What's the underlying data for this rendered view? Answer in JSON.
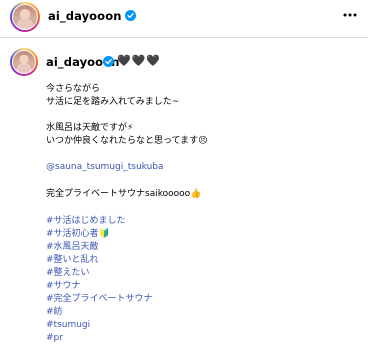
{
  "header": {
    "username": "ai_dayooon"
  },
  "caption": {
    "username": "ai_dayooon",
    "hearts": "🖤🖤🖤",
    "lines": [
      "今さらながら",
      "サ活に足を踏み入れてみました~",
      "水風呂は天敵ですが",
      "いつか仲良くなれたらなと思ってます",
      "@sauna_tsumugi_tsukuba",
      "完全プライベートサウナsaikooooo"
    ],
    "emojis": {
      "lightning": "⚡",
      "worried": "😣",
      "thumbs": "👍",
      "beginner": "🔰"
    },
    "hashtags": [
      "#サ活はじめました",
      "#サ活初心者",
      "#水風呂天敵",
      "#整いと乱れ",
      "#整えたい",
      "#サウナ",
      "#完全プライベートサウナ",
      "#紡",
      "#tsumugi",
      "#pr"
    ]
  },
  "colors": {
    "link": "#3b56b6",
    "verified": "#0095f6"
  }
}
